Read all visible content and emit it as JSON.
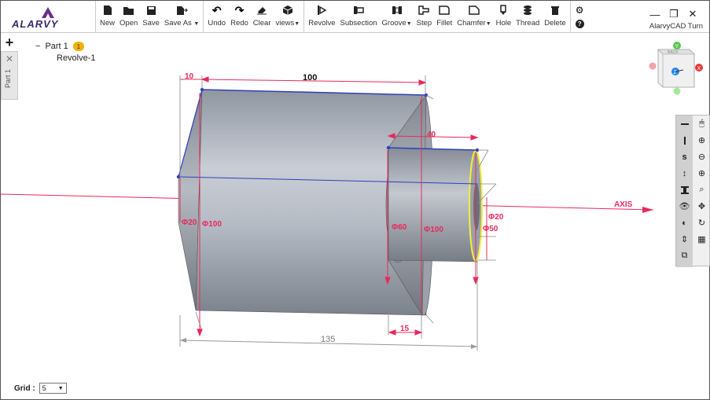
{
  "app": {
    "title": "AlarvyCAD Turn",
    "brand": "ALARVY"
  },
  "toolbar": {
    "file": [
      {
        "label": "New",
        "icon": "new-file-icon"
      },
      {
        "label": "Open",
        "icon": "open-folder-icon"
      },
      {
        "label": "Save",
        "icon": "save-icon"
      },
      {
        "label": "Save As",
        "icon": "save-as-icon",
        "dropdown": true
      }
    ],
    "edit": [
      {
        "label": "Undo",
        "icon": "undo-icon"
      },
      {
        "label": "Redo",
        "icon": "redo-icon"
      },
      {
        "label": "Clear",
        "icon": "eraser-icon"
      },
      {
        "label": "views",
        "icon": "cube-icon",
        "dropdown": true
      }
    ],
    "features": [
      {
        "label": "Revolve",
        "icon": "revolve-icon"
      },
      {
        "label": "Subsection",
        "icon": "subsection-icon"
      },
      {
        "label": "Groove",
        "icon": "groove-icon",
        "dropdown": true
      },
      {
        "label": "Step",
        "icon": "step-icon"
      },
      {
        "label": "Fillet",
        "icon": "fillet-icon"
      },
      {
        "label": "Chamfer",
        "icon": "chamfer-icon",
        "dropdown": true
      },
      {
        "label": "Hole",
        "icon": "hole-icon"
      },
      {
        "label": "Thread",
        "icon": "thread-icon"
      },
      {
        "label": "Delete",
        "icon": "trash-icon"
      }
    ]
  },
  "left_rail": {
    "add": "+",
    "close": "✕",
    "tab_label": "Part 1"
  },
  "tree": {
    "root": "Part 1",
    "badge": "1",
    "child": "Revolve-1"
  },
  "viewcube": {
    "y": "Y",
    "x": "X",
    "z": "Z",
    "face": "BACK"
  },
  "dimensions": {
    "d10": "10",
    "d100": "100",
    "d40": "40",
    "d15": "15",
    "d135": "135",
    "phi20_left": "Φ20",
    "phi100_left": "Φ100",
    "phi60": "Φ60",
    "phi100_right": "Φ100",
    "phi20_right": "Φ20",
    "phi50": "Φ50",
    "axis": "AXIS"
  },
  "grid": {
    "label": "Grid :",
    "value": "5"
  },
  "colors": {
    "dimension": "#e8295b",
    "edge": "#2f3fb8",
    "highlight": "#f2ef3a",
    "body": "#a7adb6"
  }
}
